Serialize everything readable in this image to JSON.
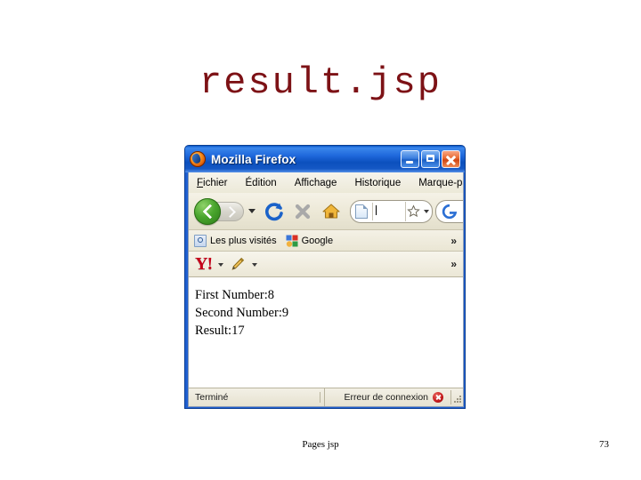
{
  "slide": {
    "title": "result.jsp",
    "footer_label": "Pages jsp",
    "page_number": "73",
    "title_color": "#7d1216",
    "background_color": "#ffffff"
  },
  "browser": {
    "titlebar": {
      "app_title": "Mozilla Firefox",
      "app_icon": "firefox-logo-icon",
      "minimize_label": "",
      "maximize_label": "",
      "close_label": "",
      "bar_color": "#1e67db"
    },
    "menubar": {
      "items": [
        {
          "label": "Fichier"
        },
        {
          "label": "Édition"
        },
        {
          "label": "Affichage"
        },
        {
          "label": "Historique"
        },
        {
          "label": "Marque-pages"
        }
      ]
    },
    "toolbar": {
      "back_icon": "back-arrow-icon",
      "forward_icon": "forward-arrow-icon",
      "history_dropdown_icon": "chevron-down-icon",
      "reload_icon": "reload-icon",
      "stop_icon": "stop-icon",
      "home_icon": "home-icon",
      "urlbar": {
        "favicon": "page-icon",
        "value": "",
        "bookmark_star_icon": "star-icon",
        "star_dropdown_icon": "chevron-down-icon"
      },
      "searchbox": {
        "engine_icon": "google-g-icon",
        "placeholder": ""
      }
    },
    "bookmarksbar": {
      "items": [
        {
          "label": "Les plus visités",
          "icon": "most-visited-icon"
        },
        {
          "label": "Google",
          "icon": "google-icon"
        }
      ],
      "overflow_label": "»"
    },
    "yahoobar": {
      "logo_text": "Y!",
      "logo_color": "#c5001a",
      "pencil_icon": "pencil-icon",
      "overflow_label": "»"
    },
    "content": {
      "lines": [
        "First Number:8",
        "Second Number:9",
        "Result:17"
      ],
      "first_number": "8",
      "second_number": "9",
      "result": "17"
    },
    "statusbar": {
      "left_text": "Terminé",
      "right_text": "Erreur de connexion",
      "error_icon": "error-icon",
      "resize_grip_icon": "resize-grip-icon"
    }
  }
}
